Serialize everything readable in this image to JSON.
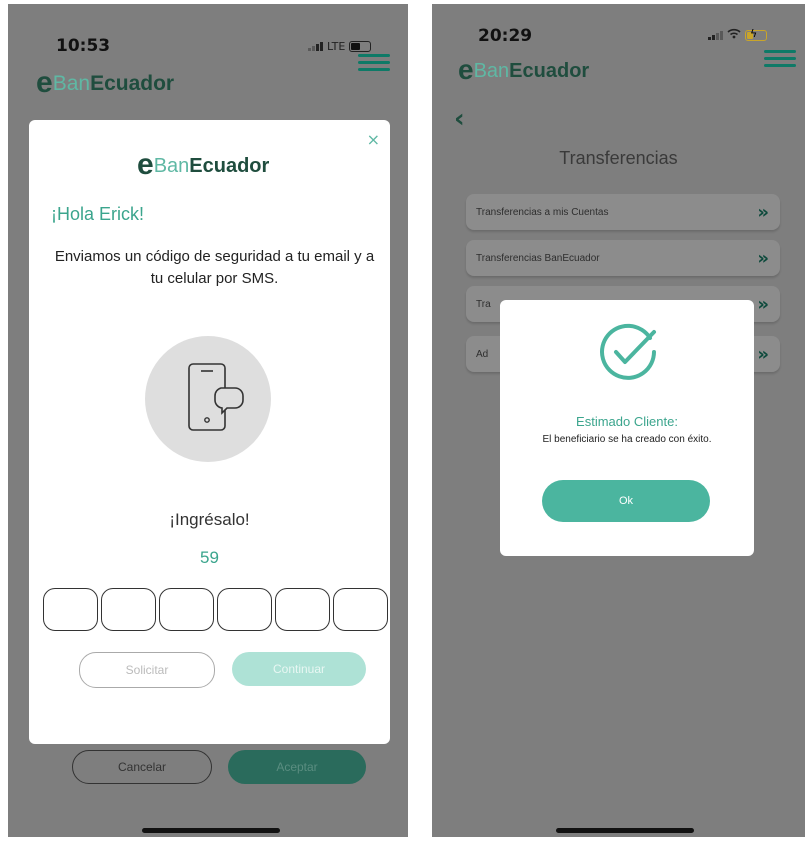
{
  "left": {
    "status": {
      "time": "10:53",
      "network": "LTE"
    },
    "brand": {
      "part1": "Ban",
      "part2": "Ecuador"
    },
    "modal": {
      "close": "×",
      "greeting": "¡Hola Erick!",
      "instructions": "Enviamos un código de seguridad a tu email y a tu celular por SMS.",
      "prompt": "¡Ingrésalo!",
      "countdown": "59",
      "code_digits": [
        "",
        "",
        "",
        "",
        "",
        ""
      ],
      "solicitar_label": "Solicitar",
      "continuar_label": "Continuar"
    },
    "footer": {
      "cancelar_label": "Cancelar",
      "aceptar_label": "Aceptar"
    }
  },
  "right": {
    "status": {
      "time": "20:29"
    },
    "brand": {
      "part1": "Ban",
      "part2": "Ecuador"
    },
    "back_icon": "‹",
    "title": "Transferencias",
    "menu": [
      {
        "label": "Transferencias a mis Cuentas",
        "chev": "»"
      },
      {
        "label": "Transferencias BanEcuador",
        "chev": "»"
      },
      {
        "label": "Tra",
        "chev": "»"
      },
      {
        "label": "Ad",
        "chev": "»"
      }
    ],
    "dialog": {
      "title": "Estimado Cliente:",
      "message": "El beneficiario se ha creado con éxito.",
      "ok_label": "Ok"
    }
  },
  "colors": {
    "brand_teal": "#4bb59f",
    "brand_dark": "#1f4d3e",
    "overlay": "#7e7e7e"
  },
  "icons": [
    "hamburger-icon",
    "phone-sms-icon",
    "check-circle-icon",
    "back-icon",
    "double-chevron-icon",
    "battery-icon",
    "signal-icon",
    "wifi-icon"
  ]
}
